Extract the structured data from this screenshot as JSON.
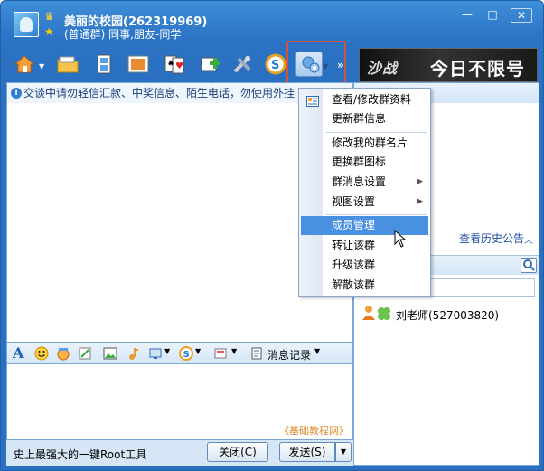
{
  "window": {
    "group_name": "美丽的校园(262319969)",
    "group_desc": "(普通群) 同事,朋友-同学",
    "minimize": "—",
    "maximize": "□",
    "close": "✕"
  },
  "toolbar": {
    "icons": [
      "home-icon",
      "folder-icon",
      "film-icon",
      "picture-icon",
      "poker-game-icon",
      "add-app-icon",
      "tools-icon",
      "s-app-icon",
      "group-settings-icon"
    ],
    "more": "»"
  },
  "ad": {
    "brand": "沙战",
    "slogan": "今日不限号"
  },
  "chat": {
    "notice": "交谈中请勿轻信汇款、中奖信息、陌生电话，勿使用外挂"
  },
  "input_toolbar": {
    "font_label": "A",
    "history_label": "消息记录"
  },
  "input": {
    "watermark": "《基础教程网》"
  },
  "bottom": {
    "promo": "史上最强大的一键Root工具",
    "close_label": "关闭(C)",
    "send_label": "发送(S)"
  },
  "right": {
    "history_link": "查看历史公告",
    "members": [
      {
        "name": "刘老师(527003820)"
      }
    ]
  },
  "menu": {
    "items": [
      {
        "label": "查看/修改群资料",
        "submenu": false
      },
      {
        "label": "更新群信息",
        "submenu": false
      },
      {
        "label": "修改我的群名片",
        "submenu": false
      },
      {
        "label": "更换群图标",
        "submenu": false
      },
      {
        "label": "群消息设置",
        "submenu": true
      },
      {
        "label": "视图设置",
        "submenu": true
      },
      {
        "label": "成员管理",
        "submenu": false,
        "highlighted": true
      },
      {
        "label": "转让该群",
        "submenu": false
      },
      {
        "label": "升级该群",
        "submenu": false
      },
      {
        "label": "解散该群",
        "submenu": false
      }
    ],
    "submenu_arrow": "▶"
  },
  "colors": {
    "title_blue": "#2c74c6",
    "menu_highlight": "#4a90e0",
    "watermark": "#e08a2b",
    "active_outline": "#d0553b"
  }
}
